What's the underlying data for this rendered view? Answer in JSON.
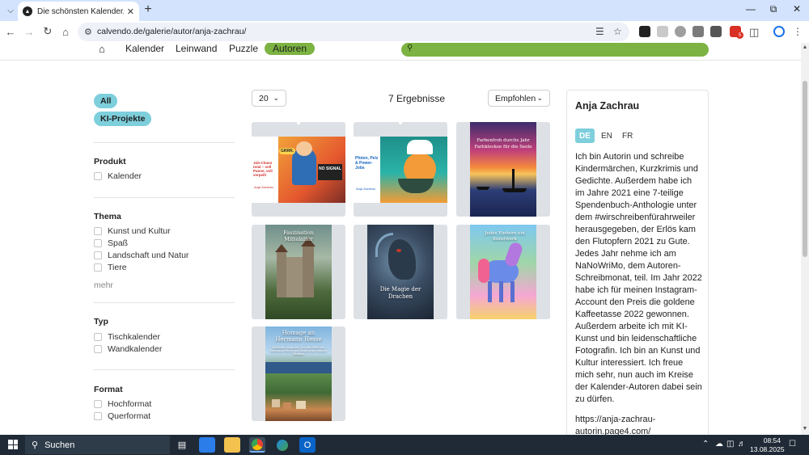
{
  "browser": {
    "tab_title": "Die schönsten Kalender, Puzzle",
    "url": "calvendo.de/galerie/autor/anja-zachrau/",
    "ext_badge_count": "5"
  },
  "nav": {
    "items": [
      "Kalender",
      "Leinwand",
      "Puzzle",
      "Autoren"
    ],
    "active": "Autoren"
  },
  "sidebar": {
    "pills": [
      "All",
      "KI-Projekte"
    ],
    "groups": [
      {
        "title": "Produkt",
        "options": [
          "Kalender"
        ]
      },
      {
        "title": "Thema",
        "options": [
          "Kunst und Kultur",
          "Spaß",
          "Landschaft und Natur",
          "Tiere"
        ],
        "more": "mehr"
      },
      {
        "title": "Typ",
        "options": [
          "Tischkalender",
          "Wandkalender"
        ]
      },
      {
        "title": "Format",
        "options": [
          "Hochformat",
          "Querformat"
        ]
      }
    ]
  },
  "results": {
    "per_page": "20",
    "count_label": "7 Ergebnisse",
    "sort": "Empfohlen"
  },
  "products": [
    {
      "id": "p1",
      "texts": [
        "Job-Chaos total – voll Panne, voll verpeilt",
        "Anja Zachrau",
        "GRRR.",
        "NO SIGNAL"
      ]
    },
    {
      "id": "p2",
      "texts": [
        "Pfoten, Pelz & Power-Jobs",
        "Anja Zachrau"
      ]
    },
    {
      "id": "p3",
      "texts": [
        "Farbenfroh durchs Jahr",
        "Farbkleckse für die Seele"
      ]
    },
    {
      "id": "p4",
      "texts": [
        "Faszination Mittelalter"
      ]
    },
    {
      "id": "p5",
      "texts": [
        "Die Magie der Drachen"
      ]
    },
    {
      "id": "p6",
      "texts": [
        "Jedes Einhorn ein Kunstwerk"
      ]
    },
    {
      "id": "p7",
      "texts": [
        "Homage an Hermann Hesse",
        "Kalender inspiriert von der Welt von Hermann Hesse mit Zitaten aus seinen Werken"
      ]
    }
  ],
  "author": {
    "name": "Anja Zachrau",
    "languages": [
      "DE",
      "EN",
      "FR"
    ],
    "active_language": "DE",
    "bio": "Ich bin Autorin und schreibe Kindermärchen, Kurzkrimis und Gedichte. Außerdem habe ich im Jahre 2021 eine 7-teilige Spendenbuch-Anthologie unter dem #wirschreibenfürahrweiler herausgegeben, der Erlös kam den Flutopfern 2021 zu Gute. Jedes Jahr nehme ich am NaNoWriMo, dem Autoren-Schreibmonat, teil. Im Jahr 2022 habe ich für meinen Instagram-Account den Preis die goldene Kaffeetasse 2022 gewonnen. Außerdem arbeite ich mit KI-Kunst und bin leidenschaftliche Fotografin. Ich bin an Kunst und Kultur interessiert. Ich freue mich sehr, nun auch im Kreise der Kalender-Autoren dabei sein zu dürfen.",
    "link": "https://anja-zachrau-autorin.page4.com/"
  },
  "taskbar": {
    "search_label": "Suchen",
    "time": "08:54",
    "date": "13.08.2025"
  },
  "colors": {
    "accent_green": "#7cb342",
    "accent_teal": "#7ecfdc",
    "chrome_blue": "#d3e3fd",
    "taskbar": "#1f2a36"
  }
}
